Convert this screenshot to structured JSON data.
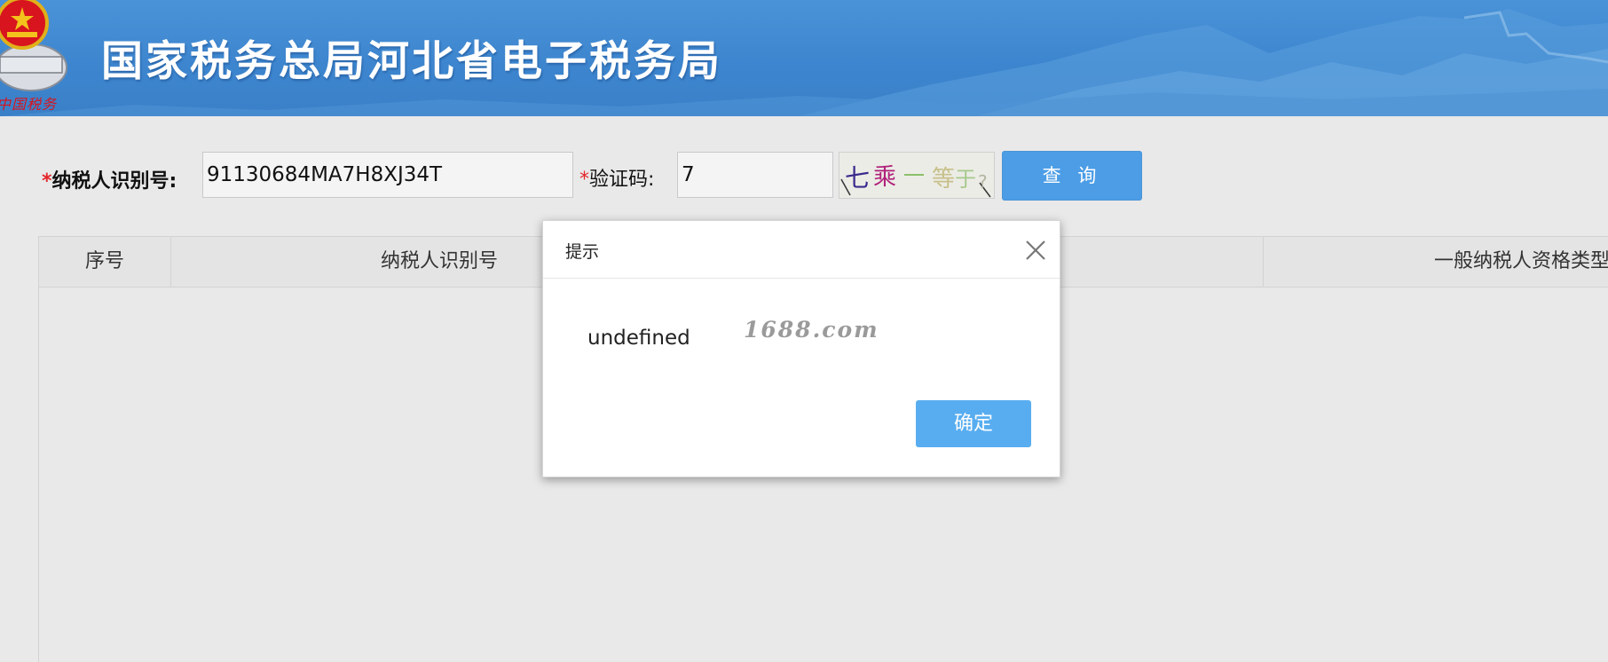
{
  "header": {
    "title": "国家税务总局河北省电子税务局",
    "emblem_motto": "中国税务",
    "emblem_icon": "national-emblem-icon"
  },
  "form": {
    "required_mark": "*",
    "taxid_label": "纳税人识别号:",
    "taxid_value": "91130684MA7H8XJ34T",
    "captcha_label": "验证码:",
    "captcha_value": "7",
    "captcha_image_text": "七乘一等于?",
    "query_button": "查 询"
  },
  "table": {
    "columns": [
      "序号",
      "纳税人识别号",
      "",
      "一般纳税人资格类型"
    ],
    "rows": []
  },
  "dialog": {
    "title": "提示",
    "message": "undefined",
    "watermark": "1688.com",
    "ok_button": "确定",
    "close_icon": "close-icon"
  },
  "colors": {
    "header_blue": "#3d86cf",
    "button_blue": "#4c9de6",
    "ok_blue": "#58adf0",
    "required_red": "#e3262c"
  }
}
